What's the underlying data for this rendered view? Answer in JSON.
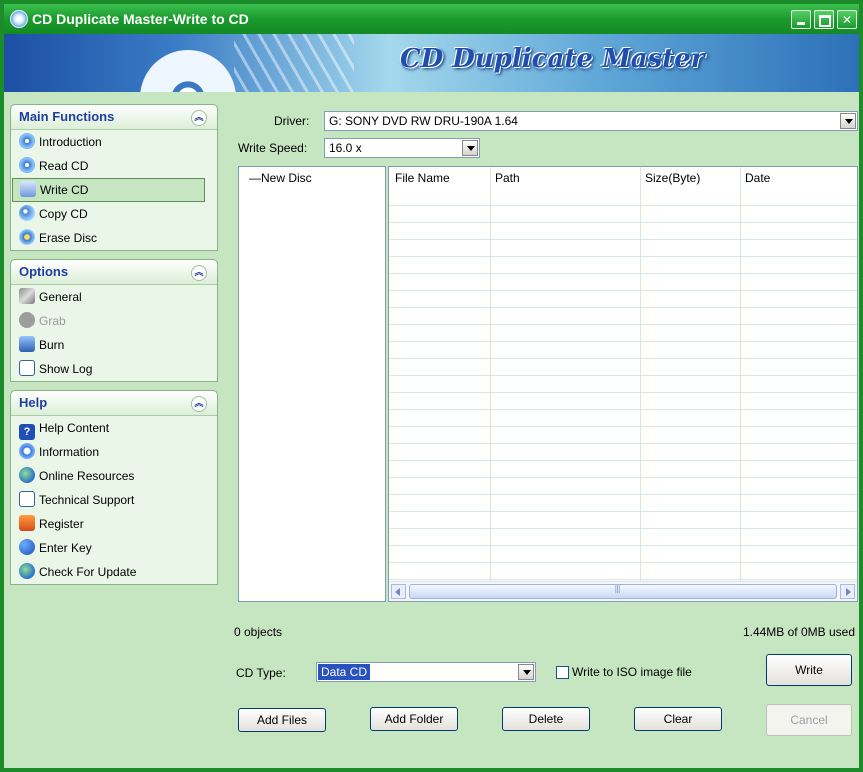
{
  "window": {
    "title": "CD Duplicate Master-Write to CD"
  },
  "banner": {
    "title": "CD Duplicate Master"
  },
  "sidebar": {
    "panels": [
      {
        "title": "Main Functions",
        "items": [
          {
            "label": "Introduction",
            "icon": "disc-icon"
          },
          {
            "label": "Read CD",
            "icon": "read-cd-icon"
          },
          {
            "label": "Write CD",
            "icon": "write-cd-icon",
            "active": true
          },
          {
            "label": "Copy CD",
            "icon": "copy-cd-icon"
          },
          {
            "label": "Erase Disc",
            "icon": "erase-disc-icon"
          }
        ]
      },
      {
        "title": "Options",
        "items": [
          {
            "label": "General",
            "icon": "general-icon"
          },
          {
            "label": "Grab",
            "icon": "grab-icon",
            "disabled": true
          },
          {
            "label": "Burn",
            "icon": "burn-icon"
          },
          {
            "label": "Show Log",
            "icon": "log-icon"
          }
        ]
      },
      {
        "title": "Help",
        "items": [
          {
            "label": "Help Content",
            "icon": "help-icon"
          },
          {
            "label": "Information",
            "icon": "info-icon"
          },
          {
            "label": "Online Resources",
            "icon": "globe-icon"
          },
          {
            "label": "Technical Support",
            "icon": "mail-icon"
          },
          {
            "label": "Register",
            "icon": "register-icon"
          },
          {
            "label": "Enter Key",
            "icon": "key-icon"
          },
          {
            "label": "Check For Update",
            "icon": "update-icon"
          }
        ]
      }
    ]
  },
  "form": {
    "driver_label": "Driver:",
    "driver_value": "G: SONY DVD RW DRU-190A 1.64",
    "speed_label": "Write Speed:",
    "speed_value": "16.0 x",
    "cd_type_label": "CD Type:",
    "cd_type_value": "Data CD",
    "iso_label": "Write to ISO image file"
  },
  "tree": {
    "root": "New Disc"
  },
  "table": {
    "columns": [
      "File Name",
      "Path",
      "Size(Byte)",
      "Date"
    ],
    "rows": []
  },
  "status": {
    "objects": "0 objects",
    "usage": "1.44MB of 0MB used"
  },
  "buttons": {
    "add_files": "Add Files",
    "add_folder": "Add Folder",
    "delete": "Delete",
    "clear": "Clear",
    "write": "Write",
    "cancel": "Cancel"
  },
  "colors": {
    "frame": "#1c8b2a",
    "panel_title": "#1f3fa0",
    "background": "#c6e6c2"
  }
}
